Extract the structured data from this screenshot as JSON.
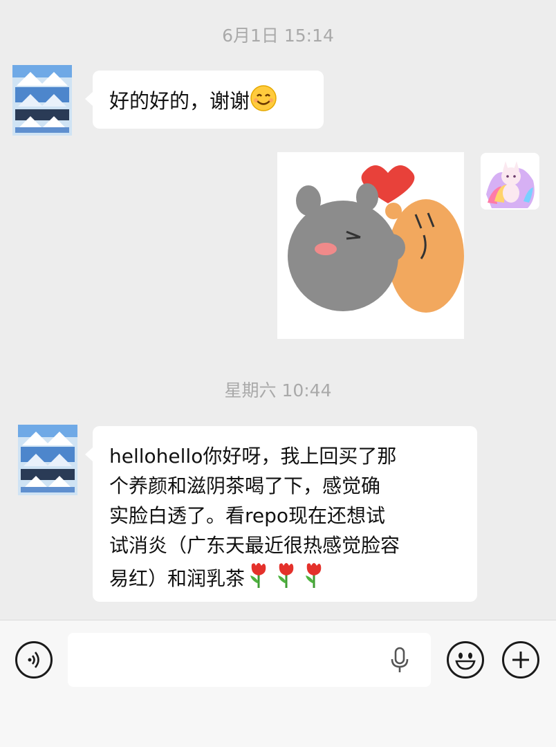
{
  "messages": [
    {
      "type": "time",
      "text": "6月1日 15:14"
    },
    {
      "type": "received",
      "text": "好的好的，谢谢",
      "emoji": "smiling-face"
    },
    {
      "type": "sent-sticker",
      "description": "sticker"
    },
    {
      "type": "time",
      "text": "星期六 10:44"
    },
    {
      "type": "received",
      "lines": [
        "hellohello你好呀，我上回买了那",
        "个养颜和滋阴茶喝了下，感觉确",
        "实脸白透了。看repo现在还想试",
        "试消炎（广东天最近很热感觉脸容",
        "易红）和润乳茶"
      ],
      "emoji": [
        "tulip",
        "tulip",
        "tulip"
      ]
    }
  ],
  "input": {
    "value": "",
    "placeholder": ""
  },
  "icons": {
    "voice": "voice-icon",
    "mic": "mic-icon",
    "emoji": "emoji-icon",
    "plus": "plus-icon"
  },
  "colors": {
    "background": "#ededed",
    "bubble": "#ffffff",
    "time": "#a9a9a9"
  }
}
